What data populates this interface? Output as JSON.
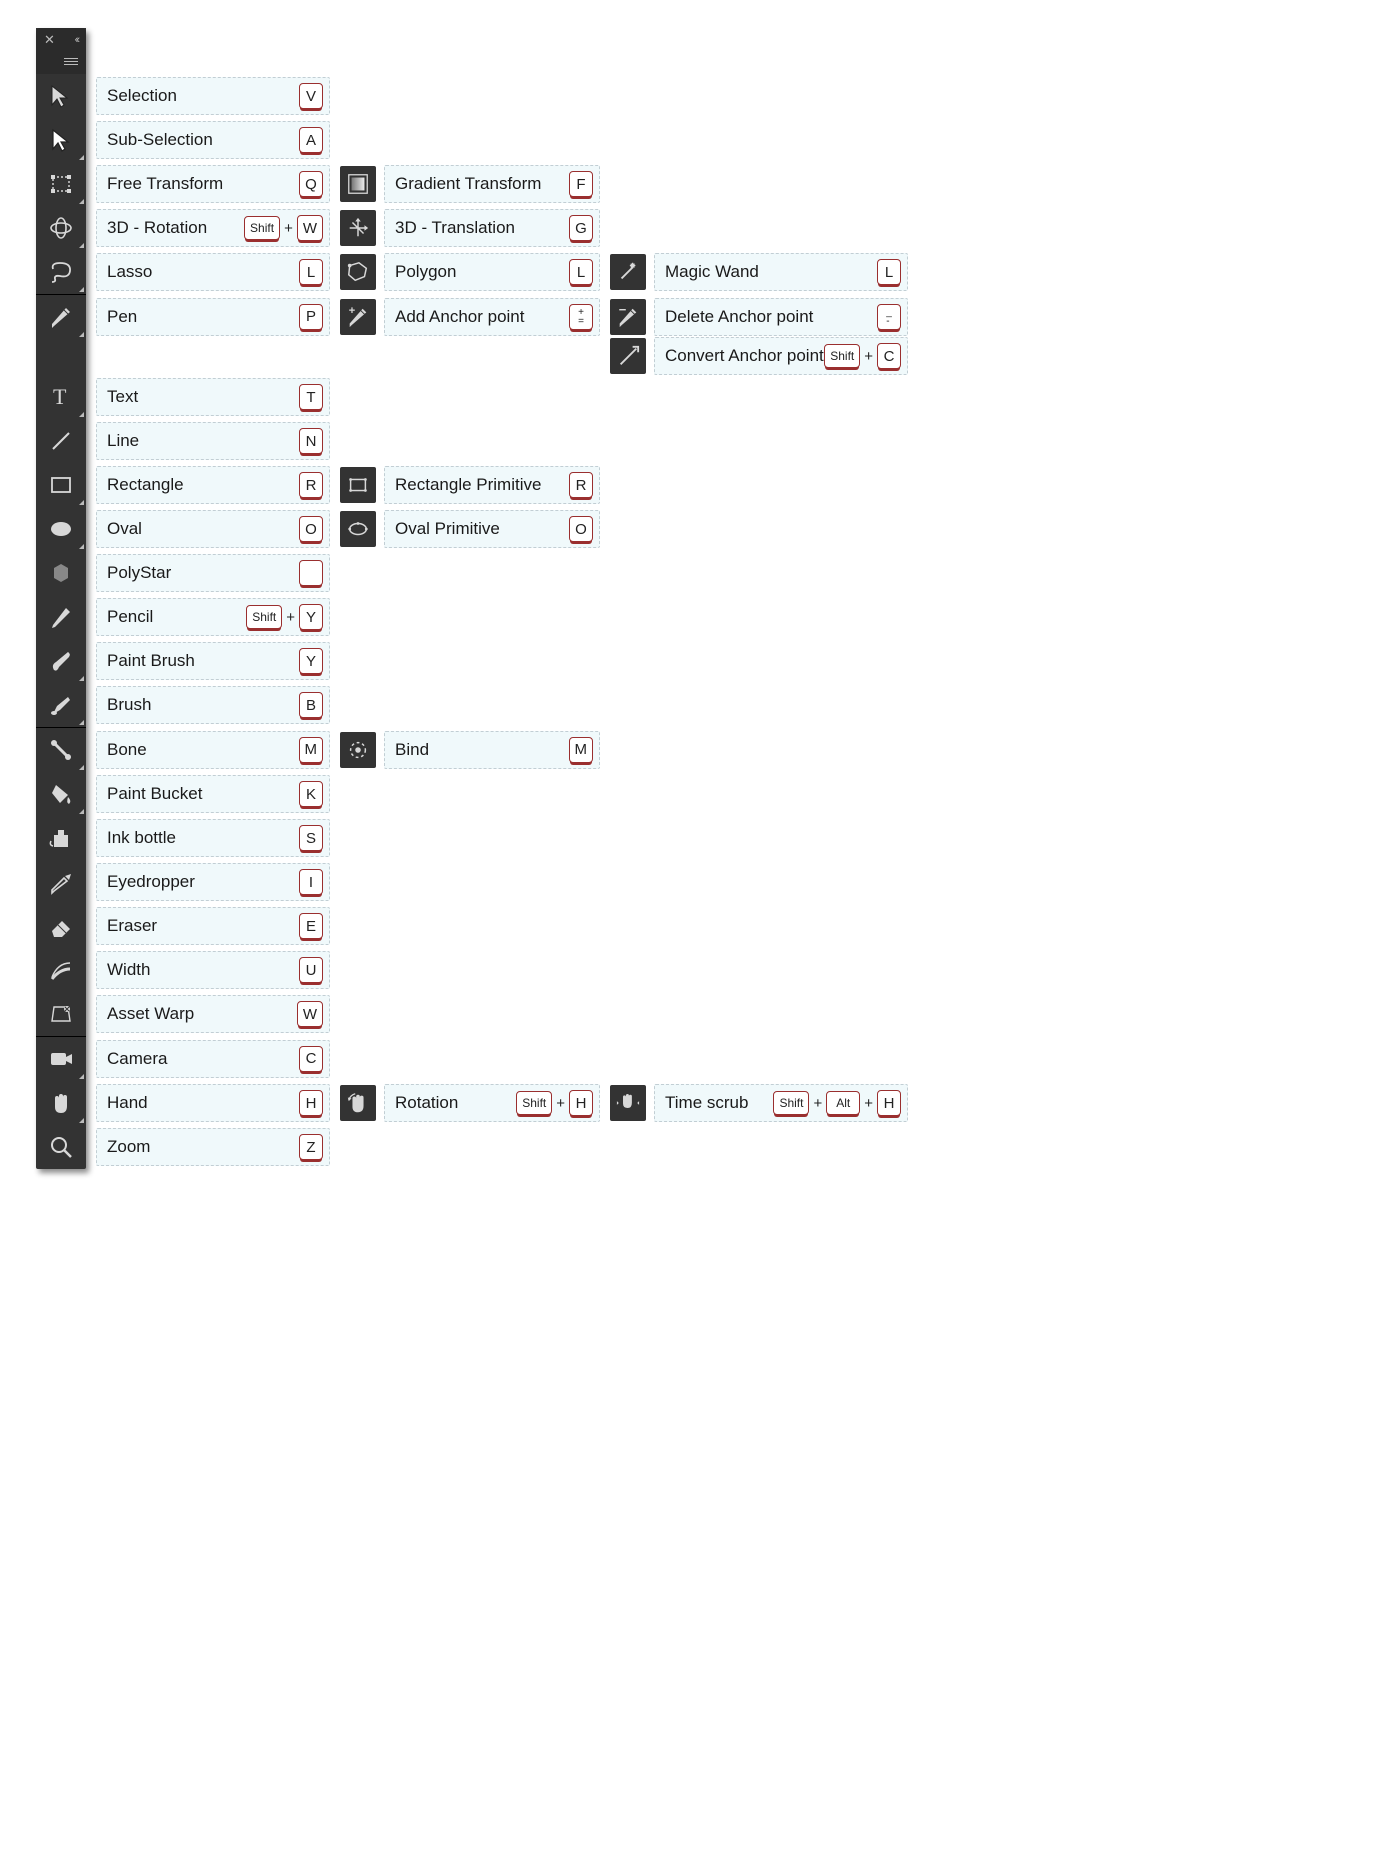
{
  "header": {
    "close_glyph": "✕",
    "collapse_glyph": "‹‹"
  },
  "modifiers": {
    "shift": "Shift",
    "alt": "Alt"
  },
  "groups": [
    {
      "rows": [
        {
          "icon": "selection",
          "flyout": false,
          "cols": [
            {
              "label": "Selection",
              "keys": [
                {
                  "key": "V"
                }
              ]
            }
          ]
        },
        {
          "icon": "subselection",
          "flyout": true,
          "cols": [
            {
              "label": "Sub-Selection",
              "keys": [
                {
                  "key": "A"
                }
              ]
            }
          ]
        },
        {
          "icon": "free-transform",
          "flyout": true,
          "cols": [
            {
              "label": "Free Transform",
              "keys": [
                {
                  "key": "Q"
                }
              ]
            },
            {
              "icon": "gradient-transform",
              "label": "Gradient Transform",
              "keys": [
                {
                  "key": "F"
                }
              ]
            }
          ]
        },
        {
          "icon": "rotate-3d",
          "flyout": true,
          "cols": [
            {
              "label": "3D - Rotation",
              "keys": [
                {
                  "mod": "shift"
                },
                {
                  "key": "W"
                }
              ]
            },
            {
              "icon": "translate-3d",
              "label": "3D - Translation",
              "keys": [
                {
                  "key": "G"
                }
              ]
            }
          ]
        },
        {
          "icon": "lasso",
          "flyout": true,
          "cols": [
            {
              "label": "Lasso",
              "keys": [
                {
                  "key": "L"
                }
              ]
            },
            {
              "icon": "polygon-lasso",
              "label": "Polygon",
              "keys": [
                {
                  "key": "L"
                }
              ]
            },
            {
              "icon": "magic-wand",
              "label": "Magic Wand",
              "keys": [
                {
                  "key": "L"
                }
              ],
              "wide": true
            }
          ]
        }
      ]
    },
    {
      "rows": [
        {
          "icon": "pen",
          "flyout": true,
          "cols": [
            {
              "label": "Pen",
              "keys": [
                {
                  "key": "P"
                }
              ]
            },
            {
              "icon": "pen-add",
              "label": "Add Anchor point",
              "keys": [
                {
                  "key": "+\n="
                }
              ]
            },
            {
              "icon": "pen-del",
              "label": "Delete Anchor point",
              "keys": [
                {
                  "key": "_\n-"
                }
              ],
              "wide": true
            }
          ],
          "extra_row": [
            {
              "icon": "convert-anchor",
              "label": "Convert Anchor point",
              "keys": [
                {
                  "mod": "shift"
                },
                {
                  "key": "C"
                }
              ],
              "wide": true
            }
          ]
        },
        {
          "icon": "text",
          "flyout": true,
          "cols": [
            {
              "label": "Text",
              "keys": [
                {
                  "key": "T"
                }
              ]
            }
          ]
        },
        {
          "icon": "line",
          "flyout": false,
          "cols": [
            {
              "label": "Line",
              "keys": [
                {
                  "key": "N"
                }
              ]
            }
          ]
        },
        {
          "icon": "rectangle",
          "flyout": true,
          "cols": [
            {
              "label": "Rectangle",
              "keys": [
                {
                  "key": "R"
                }
              ]
            },
            {
              "icon": "rectangle-primitive",
              "label": "Rectangle Primitive",
              "keys": [
                {
                  "key": "R"
                }
              ]
            }
          ]
        },
        {
          "icon": "oval",
          "flyout": true,
          "cols": [
            {
              "label": "Oval",
              "keys": [
                {
                  "key": "O"
                }
              ]
            },
            {
              "icon": "oval-primitive",
              "label": "Oval Primitive",
              "keys": [
                {
                  "key": "O"
                }
              ]
            }
          ]
        },
        {
          "icon": "polystar",
          "flyout": false,
          "cols": [
            {
              "label": "PolyStar",
              "keys": [
                {
                  "key": " "
                }
              ]
            }
          ]
        },
        {
          "icon": "pencil",
          "flyout": false,
          "cols": [
            {
              "label": "Pencil",
              "keys": [
                {
                  "mod": "shift"
                },
                {
                  "key": "Y"
                }
              ]
            }
          ]
        },
        {
          "icon": "paintbrush",
          "flyout": true,
          "cols": [
            {
              "label": "Paint Brush",
              "keys": [
                {
                  "key": "Y"
                }
              ]
            }
          ]
        },
        {
          "icon": "brush",
          "flyout": true,
          "cols": [
            {
              "label": "Brush",
              "keys": [
                {
                  "key": "B"
                }
              ]
            }
          ]
        }
      ]
    },
    {
      "rows": [
        {
          "icon": "bone",
          "flyout": true,
          "cols": [
            {
              "label": "Bone",
              "keys": [
                {
                  "key": "M"
                }
              ]
            },
            {
              "icon": "bind",
              "label": "Bind",
              "keys": [
                {
                  "key": "M"
                }
              ]
            }
          ]
        },
        {
          "icon": "paint-bucket",
          "flyout": true,
          "cols": [
            {
              "label": "Paint Bucket",
              "keys": [
                {
                  "key": "K"
                }
              ]
            }
          ]
        },
        {
          "icon": "ink-bottle",
          "flyout": false,
          "cols": [
            {
              "label": "Ink bottle",
              "keys": [
                {
                  "key": "S"
                }
              ]
            }
          ]
        },
        {
          "icon": "eyedropper",
          "flyout": false,
          "cols": [
            {
              "label": "Eyedropper",
              "keys": [
                {
                  "key": "I"
                }
              ]
            }
          ]
        },
        {
          "icon": "eraser",
          "flyout": false,
          "cols": [
            {
              "label": "Eraser",
              "keys": [
                {
                  "key": "E"
                }
              ]
            }
          ]
        },
        {
          "icon": "width",
          "flyout": false,
          "cols": [
            {
              "label": "Width",
              "keys": [
                {
                  "key": "U"
                }
              ]
            }
          ]
        },
        {
          "icon": "asset-warp",
          "flyout": false,
          "cols": [
            {
              "label": "Asset Warp",
              "keys": [
                {
                  "key": "W"
                }
              ]
            }
          ]
        }
      ]
    },
    {
      "rows": [
        {
          "icon": "camera",
          "flyout": true,
          "cols": [
            {
              "label": "Camera",
              "keys": [
                {
                  "key": "C"
                }
              ]
            }
          ]
        },
        {
          "icon": "hand",
          "flyout": true,
          "cols": [
            {
              "label": "Hand",
              "keys": [
                {
                  "key": "H"
                }
              ]
            },
            {
              "icon": "rotation-hand",
              "label": "Rotation",
              "keys": [
                {
                  "mod": "shift"
                },
                {
                  "key": "H"
                }
              ]
            },
            {
              "icon": "time-scrub",
              "label": "Time scrub",
              "keys": [
                {
                  "mod": "shift"
                },
                {
                  "mod": "alt"
                },
                {
                  "key": "H"
                }
              ],
              "wide": true
            }
          ]
        },
        {
          "icon": "zoom",
          "flyout": false,
          "cols": [
            {
              "label": "Zoom",
              "keys": [
                {
                  "key": "Z"
                }
              ]
            }
          ]
        }
      ]
    }
  ]
}
